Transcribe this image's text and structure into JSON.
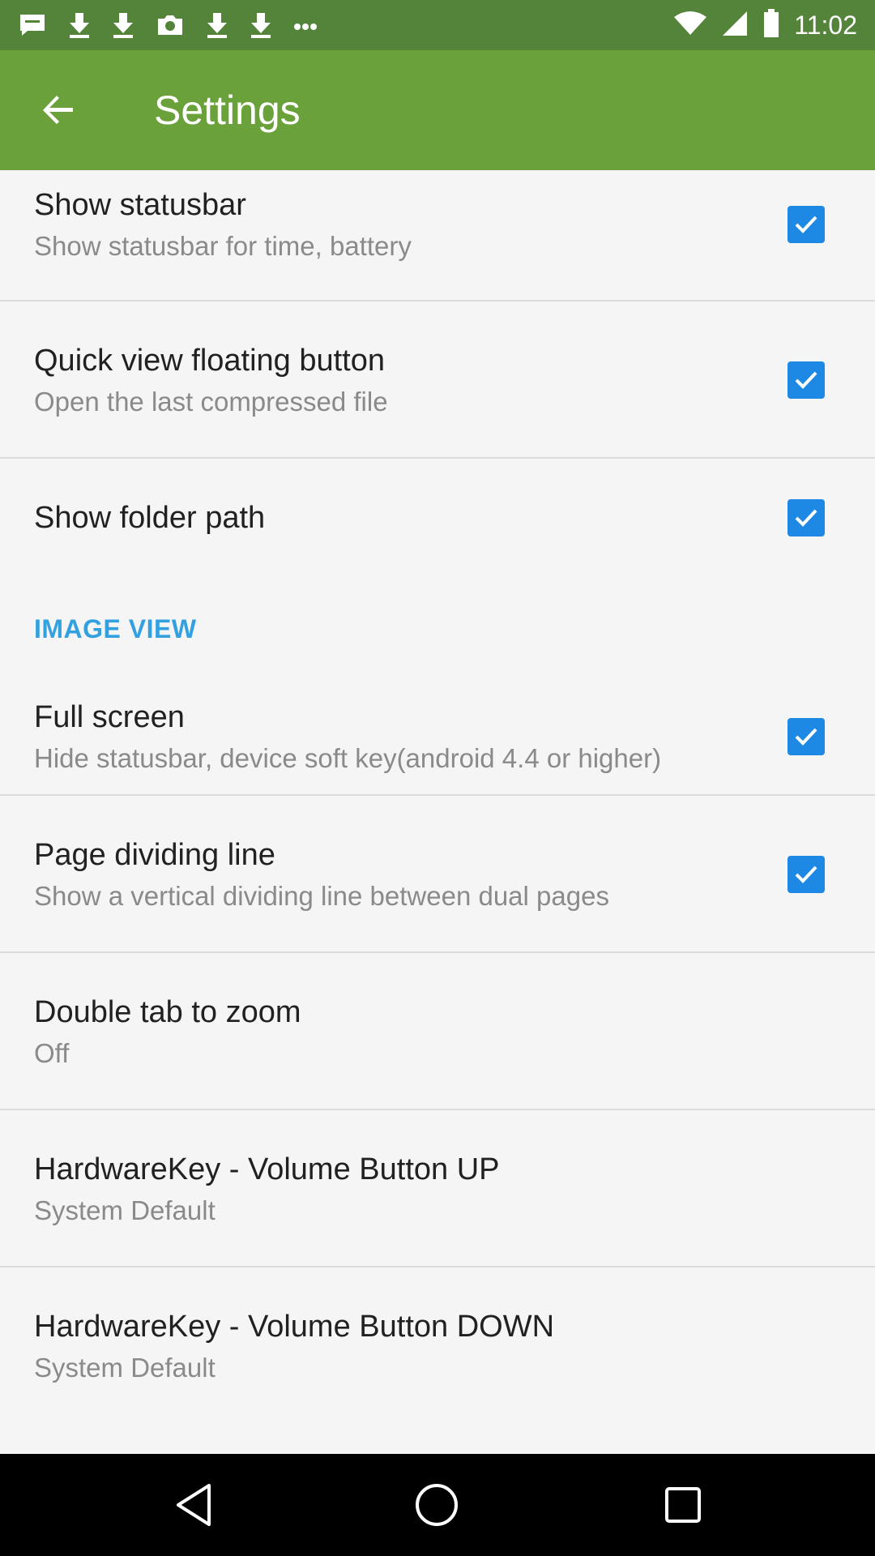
{
  "status_bar": {
    "time": "11:02",
    "left_icons": [
      "chat-icon",
      "download-icon",
      "download-icon",
      "camera-icon",
      "download-icon",
      "download-icon",
      "more-dots-icon"
    ],
    "right_icons": [
      "wifi-icon",
      "signal-icon",
      "battery-icon"
    ]
  },
  "toolbar": {
    "title": "Settings",
    "back_icon": "arrow-left-icon",
    "color": "#6aa13b"
  },
  "settings": [
    {
      "title": "Show statusbar",
      "summary": "Show statusbar for time, battery",
      "checked": true
    },
    {
      "title": "Quick view floating button",
      "summary": "Open the last compressed file",
      "checked": true
    },
    {
      "title": "Show folder path",
      "summary": "",
      "checked": true
    }
  ],
  "image_view": {
    "header": "IMAGE VIEW",
    "items": [
      {
        "title": "Full screen",
        "summary": "Hide statusbar, device soft key(android 4.4 or higher)",
        "checked": true
      },
      {
        "title": "Page dividing line",
        "summary": "Show a vertical dividing line between dual pages",
        "checked": true
      },
      {
        "title": "Double tab to zoom",
        "summary": "Off"
      },
      {
        "title": "HardwareKey - Volume Button UP",
        "summary": "System Default"
      },
      {
        "title": "HardwareKey - Volume Button DOWN",
        "summary": "System Default"
      }
    ]
  },
  "nav_bar": {
    "icons": [
      "back-triangle-icon",
      "home-circle-icon",
      "recents-square-icon"
    ]
  },
  "colors": {
    "accent": "#1e88e5",
    "section_header": "#33a1e0",
    "status_bar": "#53843a"
  }
}
